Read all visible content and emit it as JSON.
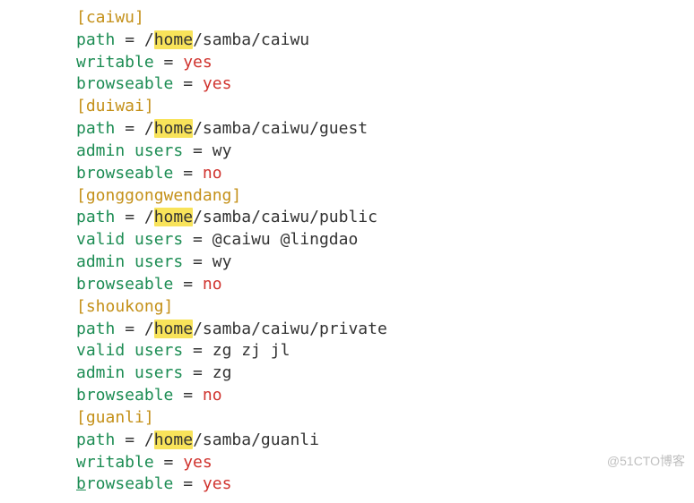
{
  "hl": "home",
  "sections": {
    "caiwu": {
      "header": "[caiwu]",
      "path_pre": "path = /",
      "path_post": "/samba/caiwu",
      "writable_k": "writable",
      "writable_v": "yes",
      "browseable_k": "browseable",
      "browseable_v": "yes"
    },
    "duiwai": {
      "header": "[duiwai]",
      "path_pre": "path = /",
      "path_post": "/samba/caiwu/guest",
      "admin_k": "admin users",
      "admin_v": "wy",
      "browseable_k": "browseable",
      "browseable_v": "no"
    },
    "ggwd": {
      "header": "[gonggongwendang]",
      "path_pre": "path = /",
      "path_post": "/samba/caiwu/public",
      "valid_k": "valid users",
      "valid_v": "@caiwu @lingdao",
      "admin_k": "admin users",
      "admin_v": "wy",
      "browseable_k": "browseable",
      "browseable_v": "no"
    },
    "shoukong": {
      "header": "[shoukong]",
      "path_pre": "path = /",
      "path_post": "/samba/caiwu/private",
      "valid_k": "valid users",
      "valid_v": "zg zj jl",
      "admin_k": "admin users",
      "admin_v": "zg",
      "browseable_k": "browseable",
      "browseable_v": "no"
    },
    "guanli": {
      "header": "[guanli]",
      "path_pre": "path = /",
      "path_post": "/samba/guanli",
      "writable_k": "writable",
      "writable_v": "yes",
      "browseable_k": "b",
      "browseable_k2": "rowseable",
      "browseable_v": "yes"
    }
  },
  "eq": " = ",
  "watermark": "@51CTO博客"
}
